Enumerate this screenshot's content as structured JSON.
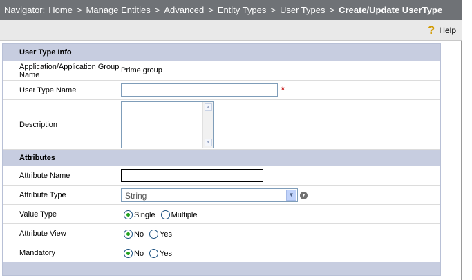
{
  "navigator": {
    "prefix": "Navigator:",
    "crumbs": [
      "Home",
      "Manage Entities",
      "Advanced",
      "Entity Types",
      "User Types"
    ],
    "current": "Create/Update UserType",
    "separator": ">"
  },
  "toolbar": {
    "help_label": "Help",
    "help_glyph": "?"
  },
  "user_type_info": {
    "header": "User Type Info",
    "app_group_label": "Application/Application Group Name",
    "app_group_value": "Prime group",
    "user_type_name_label": "User Type Name",
    "user_type_name_value": "",
    "required_mark": "*",
    "description_label": "Description",
    "description_value": ""
  },
  "attributes": {
    "header": "Attributes",
    "attribute_name_label": "Attribute Name",
    "attribute_name_value": "",
    "attribute_type_label": "Attribute Type",
    "attribute_type_value": "String",
    "value_type_label": "Value Type",
    "value_type_options": [
      "Single",
      "Multiple"
    ],
    "value_type_selected": "Single",
    "attribute_view_label": "Attribute View",
    "attribute_view_options": [
      "No",
      "Yes"
    ],
    "attribute_view_selected": "No",
    "mandatory_label": "Mandatory",
    "mandatory_options": [
      "No",
      "Yes"
    ],
    "mandatory_selected": "No"
  },
  "figure_id": "275076"
}
